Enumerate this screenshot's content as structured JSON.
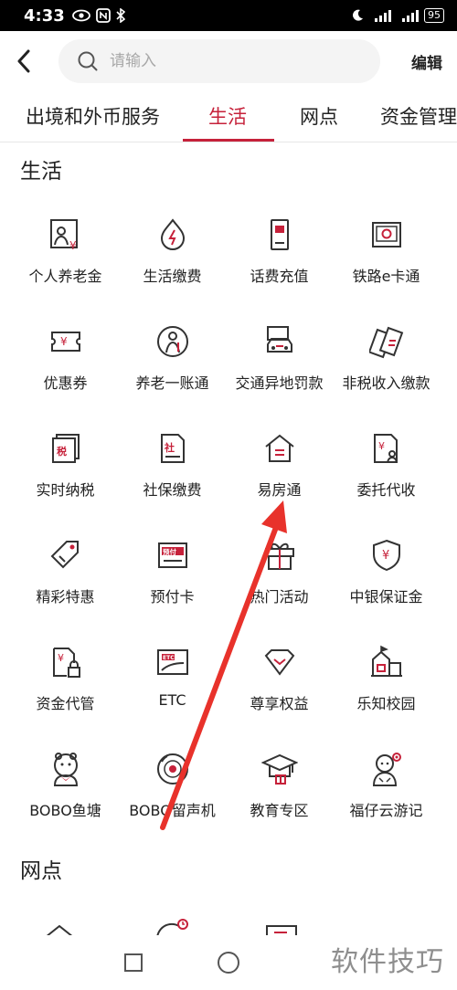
{
  "status_bar": {
    "time": "4:33",
    "battery": "95"
  },
  "header": {
    "search_placeholder": "请输入",
    "edit_label": "编辑"
  },
  "tabs": [
    {
      "label": "出境和外币服务",
      "active": false
    },
    {
      "label": "生活",
      "active": true
    },
    {
      "label": "网点",
      "active": false
    },
    {
      "label": "资金管理",
      "active": false
    }
  ],
  "section_life": {
    "title": "生活",
    "items": [
      {
        "label": "个人养老金",
        "icon": "person-pension-icon"
      },
      {
        "label": "生活缴费",
        "icon": "lightning-drop-icon"
      },
      {
        "label": "话费充值",
        "icon": "phone-recharge-icon"
      },
      {
        "label": "铁路e卡通",
        "icon": "railway-card-icon"
      },
      {
        "label": "优惠券",
        "icon": "coupon-icon"
      },
      {
        "label": "养老一账通",
        "icon": "elderly-icon"
      },
      {
        "label": "交通异地罚款",
        "icon": "car-fine-icon"
      },
      {
        "label": "非税收入缴款",
        "icon": "tax-cards-icon"
      },
      {
        "label": "实时纳税",
        "icon": "tax-doc-icon"
      },
      {
        "label": "社保缴费",
        "icon": "social-security-icon"
      },
      {
        "label": "易房通",
        "icon": "house-icon"
      },
      {
        "label": "委托代收",
        "icon": "entrust-icon"
      },
      {
        "label": "精彩特惠",
        "icon": "tag-icon"
      },
      {
        "label": "预付卡",
        "icon": "prepaid-card-icon"
      },
      {
        "label": "热门活动",
        "icon": "gift-icon"
      },
      {
        "label": "中银保证金",
        "icon": "shield-yen-icon"
      },
      {
        "label": "资金代管",
        "icon": "fund-lock-icon"
      },
      {
        "label": "ETC",
        "icon": "etc-card-icon"
      },
      {
        "label": "尊享权益",
        "icon": "diamond-icon"
      },
      {
        "label": "乐知校园",
        "icon": "school-icon"
      },
      {
        "label": "BOBO鱼塘",
        "icon": "bobo-mascot-icon"
      },
      {
        "label": "BOBO留声机",
        "icon": "record-player-icon"
      },
      {
        "label": "教育专区",
        "icon": "graduation-cap-icon"
      },
      {
        "label": "福仔云游记",
        "icon": "fuzai-mascot-icon"
      }
    ]
  },
  "section_branch": {
    "title": "网点"
  },
  "watermark": "软件技巧",
  "colors": {
    "accent": "#c6213a",
    "icon_dark": "#333333",
    "arrow": "#e8322b"
  }
}
